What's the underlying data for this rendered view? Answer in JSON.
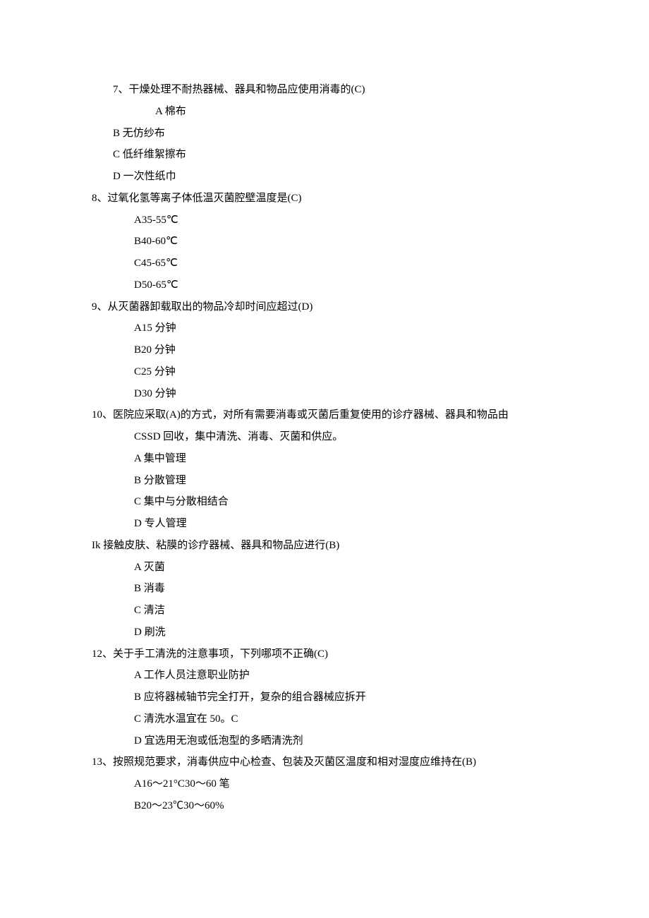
{
  "lines": [
    {
      "cls": "i1",
      "name": "q7-stem",
      "text": "7、干燥处理不耐热器械、器具和物品应使用消毒的(C)"
    },
    {
      "cls": "i3",
      "name": "q7-opt-a",
      "text": "A 棉布"
    },
    {
      "cls": "i1",
      "name": "q7-opt-b",
      "text": "B 无仿纱布"
    },
    {
      "cls": "i1",
      "name": "q7-opt-c",
      "text": "C 低纤维絮擦布"
    },
    {
      "cls": "i1",
      "name": "q7-opt-d",
      "text": "D 一次性纸巾"
    },
    {
      "cls": "i0",
      "name": "q8-stem",
      "text": "8、过氧化氢等离子体低温灭菌腔壁温度是(C)"
    },
    {
      "cls": "i2",
      "name": "q8-opt-a",
      "text": "A35-55℃"
    },
    {
      "cls": "i2",
      "name": "q8-opt-b",
      "text": "B40-60℃"
    },
    {
      "cls": "i2",
      "name": "q8-opt-c",
      "text": "C45-65℃"
    },
    {
      "cls": "i2",
      "name": "q8-opt-d",
      "text": "D50-65℃"
    },
    {
      "cls": "i0",
      "name": "q9-stem",
      "text": "9、从灭菌器卸载取出的物品冷却时间应超过(D)"
    },
    {
      "cls": "i2",
      "name": "q9-opt-a",
      "text": "A15 分钟"
    },
    {
      "cls": "i2",
      "name": "q9-opt-b",
      "text": "B20 分钟"
    },
    {
      "cls": "i2",
      "name": "q9-opt-c",
      "text": "C25 分钟"
    },
    {
      "cls": "i2",
      "name": "q9-opt-d",
      "text": "D30 分钟"
    },
    {
      "cls": "i0",
      "name": "q10-stem-l1",
      "text": "10、医院应采取(A)的方式，对所有需要消毒或灭菌后重复使用的诊疗器械、器具和物品由"
    },
    {
      "cls": "i2",
      "name": "q10-stem-l2",
      "text": "CSSD 回收，集中清洗、消毒、灭菌和供应。"
    },
    {
      "cls": "i2",
      "name": "q10-opt-a",
      "text": "A 集中管理"
    },
    {
      "cls": "i2",
      "name": "q10-opt-b",
      "text": "B 分散管理"
    },
    {
      "cls": "i2",
      "name": "q10-opt-c",
      "text": "C 集中与分散相结合"
    },
    {
      "cls": "i2",
      "name": "q10-opt-d",
      "text": "D 专人管理"
    },
    {
      "cls": "i0",
      "name": "q11-stem",
      "text": "Ik 接触皮肤、粘膜的诊疗器械、器具和物品应进行(B)"
    },
    {
      "cls": "i2",
      "name": "q11-opt-a",
      "text": "A 灭菌"
    },
    {
      "cls": "i2",
      "name": "q11-opt-b",
      "text": "B 消毒"
    },
    {
      "cls": "i2",
      "name": "q11-opt-c",
      "text": "C 清洁"
    },
    {
      "cls": "i2",
      "name": "q11-opt-d",
      "text": "D 刷洗"
    },
    {
      "cls": "i0",
      "name": "q12-stem",
      "text": "12、关于手工清洗的注意事项，下列哪项不正确(C)"
    },
    {
      "cls": "i2",
      "name": "q12-opt-a",
      "text": "A 工作人员注意职业防护"
    },
    {
      "cls": "i2",
      "name": "q12-opt-b",
      "text": "B 应将器械轴节完全打开，复杂的组合器械应拆开"
    },
    {
      "cls": "i2",
      "name": "q12-opt-c",
      "text": "C 清洗水温宜在 50。C"
    },
    {
      "cls": "i2",
      "name": "q12-opt-d",
      "text": "D 宜选用无泡或低泡型的多晒清洗剂"
    },
    {
      "cls": "i0",
      "name": "q13-stem",
      "text": "13、按照规范要求，消毒供应中心检查、包装及灭菌区温度和相对湿度应维持在(B)"
    },
    {
      "cls": "i2",
      "name": "q13-opt-a",
      "text": "A16～21°C30～60 笔"
    },
    {
      "cls": "i2",
      "name": "q13-opt-b",
      "text": "B20～23℃30～60%"
    }
  ]
}
